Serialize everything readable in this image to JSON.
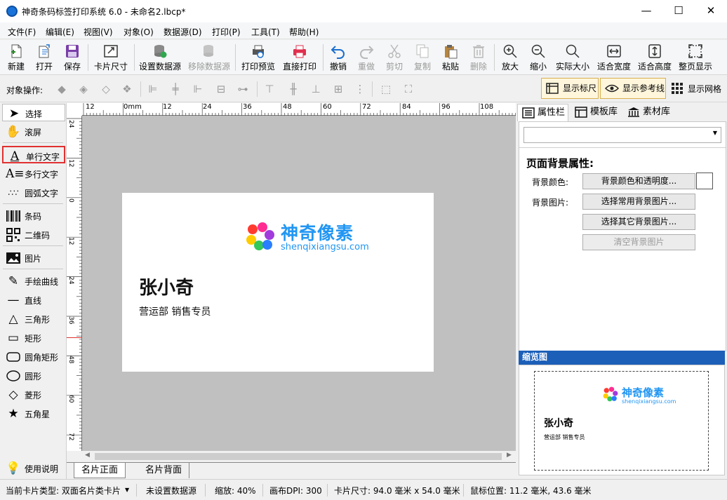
{
  "window": {
    "title": "神奇条码标签打印系统 6.0 - 未命名2.lbcp*",
    "minimize": "—",
    "maximize": "☐",
    "close": "✕"
  },
  "menu": [
    "文件(F)",
    "编辑(E)",
    "视图(V)",
    "对象(O)",
    "数据源(D)",
    "打印(P)",
    "工具(T)",
    "帮助(H)"
  ],
  "toolbar": {
    "new": "新建",
    "open": "打开",
    "save": "保存",
    "card_size": "卡片尺寸",
    "set_datasource": "设置数据源",
    "remove_datasource": "移除数据源",
    "print_preview": "打印预览",
    "direct_print": "直接打印",
    "undo": "撤销",
    "redo": "重做",
    "cut": "剪切",
    "copy": "复制",
    "paste": "粘贴",
    "delete": "删除",
    "zoom_in": "放大",
    "zoom_out": "缩小",
    "actual_size": "实际大小",
    "fit_width": "适合宽度",
    "fit_height": "适合高度",
    "fit_page": "整页显示"
  },
  "objbar": {
    "label": "对象操作:",
    "show_ruler": "显示标尺",
    "show_guides": "显示参考线",
    "show_grid": "显示网格"
  },
  "tools": {
    "select": "选择",
    "scroll": "滚屏",
    "single_text": "单行文字",
    "multi_text": "多行文字",
    "arc_text": "圆弧文字",
    "barcode": "条码",
    "qrcode": "二维码",
    "image": "图片",
    "freehand": "手绘曲线",
    "line": "直线",
    "triangle": "三角形",
    "rect": "矩形",
    "round_rect": "圆角矩形",
    "circle": "圆形",
    "diamond": "菱形",
    "star": "五角星",
    "help": "使用说明"
  },
  "ruler": {
    "h_labels": [
      "12",
      "0mm",
      "12",
      "24",
      "36",
      "48",
      "60",
      "72",
      "84",
      "96",
      "108"
    ],
    "v_labels": [
      "24",
      "12",
      "0",
      "12",
      "24",
      "36",
      "48",
      "60",
      "72"
    ]
  },
  "card": {
    "brand_name": "神奇像素",
    "brand_url": "shenqixiangsu.com",
    "person_name": "张小奇",
    "person_title": "营运部 销售专员"
  },
  "page_tabs": [
    "名片正面",
    "名片背面"
  ],
  "right_panel": {
    "tabs": [
      "属性栏",
      "模板库",
      "素材库"
    ],
    "dropdown_value": "",
    "section_title": "页面背景属性:",
    "bg_color_label": "背景颜色:",
    "bg_color_button": "背景颜色和透明度...",
    "bg_image_label": "背景图片:",
    "bg_image_common": "选择常用背景图片...",
    "bg_image_other": "选择其它背景图片...",
    "bg_image_clear": "清空背景图片",
    "preview_title": "缩览图"
  },
  "status": {
    "card_type": "当前卡片类型: 双面名片类卡片",
    "datasource": "未设置数据源",
    "zoom": "缩放: 40%",
    "dpi": "画布DPI: 300",
    "card_size": "卡片尺寸: 94.0 毫米 x 54.0 毫米",
    "mouse_pos": "鼠标位置: 11.2 毫米, 43.6 毫米"
  },
  "colors": {
    "accent_blue": "#1a6fd0",
    "preview_header": "#1c5fb8",
    "highlight_red": "#e03030",
    "brand_text": "#2196f3"
  }
}
